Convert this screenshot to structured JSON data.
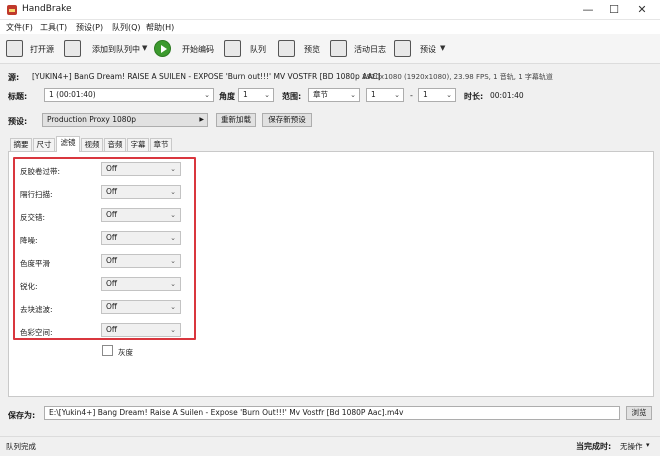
{
  "window": {
    "title": "HandBrake",
    "controls": {
      "minimize": "—",
      "maximize": "☐",
      "close": "✕"
    }
  },
  "menu": [
    "文件(F)",
    "工具(T)",
    "预设(P)",
    "队列(Q)",
    "帮助(H)"
  ],
  "toolbar": {
    "open_source": "打开源",
    "add_to_queue": "添加到队列中",
    "start_encode": "开始编码",
    "queue": "队列",
    "preview": "预览",
    "activity_log": "活动日志",
    "presets": "预设"
  },
  "source": {
    "label": "源:",
    "name": "[YUKIN4+] BanG Dream! RAISE A SUILEN - EXPOSE 'Burn out!!!' MV VOSTFR [BD 1080p AAC]",
    "info": "1920x1080 (1920x1080), 23.98 FPS, 1 音轨, 1 字幕轨道"
  },
  "title_row": {
    "title_label": "标题:",
    "title_value": "1 (00:01:40)",
    "angle_label": "角度",
    "angle_value": "1",
    "range_label": "范围:",
    "range_type": "章节",
    "range_start": "1",
    "range_sep": "-",
    "range_end": "1",
    "duration_label": "时长:",
    "duration_value": "00:01:40"
  },
  "preset_row": {
    "label": "预设:",
    "value": "Production Proxy 1080p",
    "reload_button": "重新加载",
    "save_new_button": "保存新预设"
  },
  "tabs": [
    "摘要",
    "尺寸",
    "滤镜",
    "视频",
    "音频",
    "字幕",
    "章节"
  ],
  "active_tab": 2,
  "filters": [
    {
      "label": "反胶卷过带:",
      "value": "Off"
    },
    {
      "label": "隔行扫描:",
      "value": "Off"
    },
    {
      "label": "反交错:",
      "value": "Off"
    },
    {
      "label": "降噪:",
      "value": "Off"
    },
    {
      "label": "色度平滑",
      "value": "Off"
    },
    {
      "label": "锐化:",
      "value": "Off"
    },
    {
      "label": "去块滤波:",
      "value": "Off"
    },
    {
      "label": "色彩空间:",
      "value": "Off"
    }
  ],
  "grayscale_label": "灰度",
  "save": {
    "label": "保存为:",
    "path": "E:\\[Yukin4+] Bang Dream! Raise A Suilen - Expose 'Burn Out!!!' Mv Vostfr [Bd 1080P Aac].m4v",
    "browse_button": "浏览"
  },
  "status": {
    "left": "队列完成",
    "when_done_label": "当完成时:",
    "when_done_value": "无操作"
  },
  "colors": {
    "highlight": "#d9363e",
    "start": "#3c9a2e"
  }
}
